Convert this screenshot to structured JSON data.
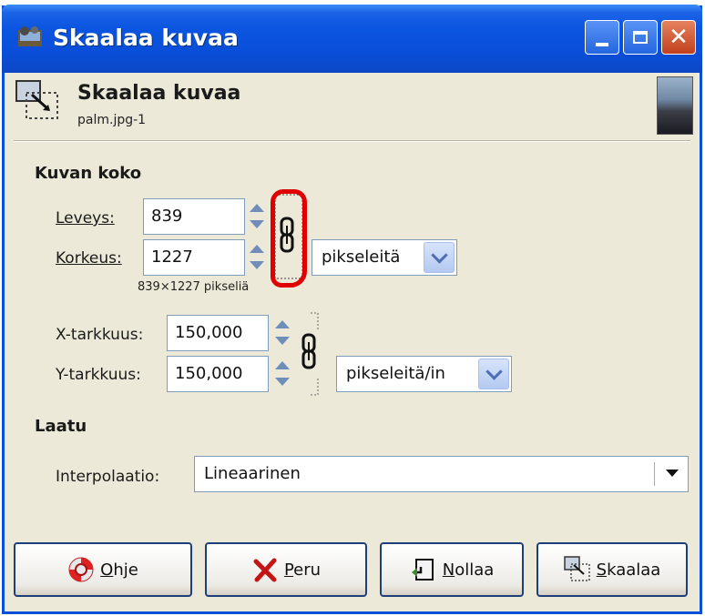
{
  "window": {
    "title": "Skaalaa kuvaa"
  },
  "header": {
    "title": "Skaalaa kuvaa",
    "subtitle": "palm.jpg-1"
  },
  "image_size": {
    "section_label": "Kuvan koko",
    "width_label": "Leveys:",
    "width_value": "839",
    "height_label": "Korkeus:",
    "height_value": "1227",
    "unit_value": "pikseleitä",
    "size_summary": "839×1227 pikseliä"
  },
  "resolution": {
    "x_label": "X-tarkkuus:",
    "x_value": "150,000",
    "y_label": "Y-tarkkuus:",
    "y_value": "150,000",
    "unit_value": "pikseleitä/in"
  },
  "quality": {
    "section_label": "Laatu",
    "interp_label": "Interpolaatio:",
    "interp_value": "Lineaarinen"
  },
  "buttons": {
    "help": "Ohje",
    "cancel": "Peru",
    "reset": "Nollaa",
    "scale": "Skaalaa"
  },
  "colors": {
    "titlebar": "#0a4ed9",
    "dialog_bg": "#ece9d8",
    "annotation": "#e00000"
  }
}
